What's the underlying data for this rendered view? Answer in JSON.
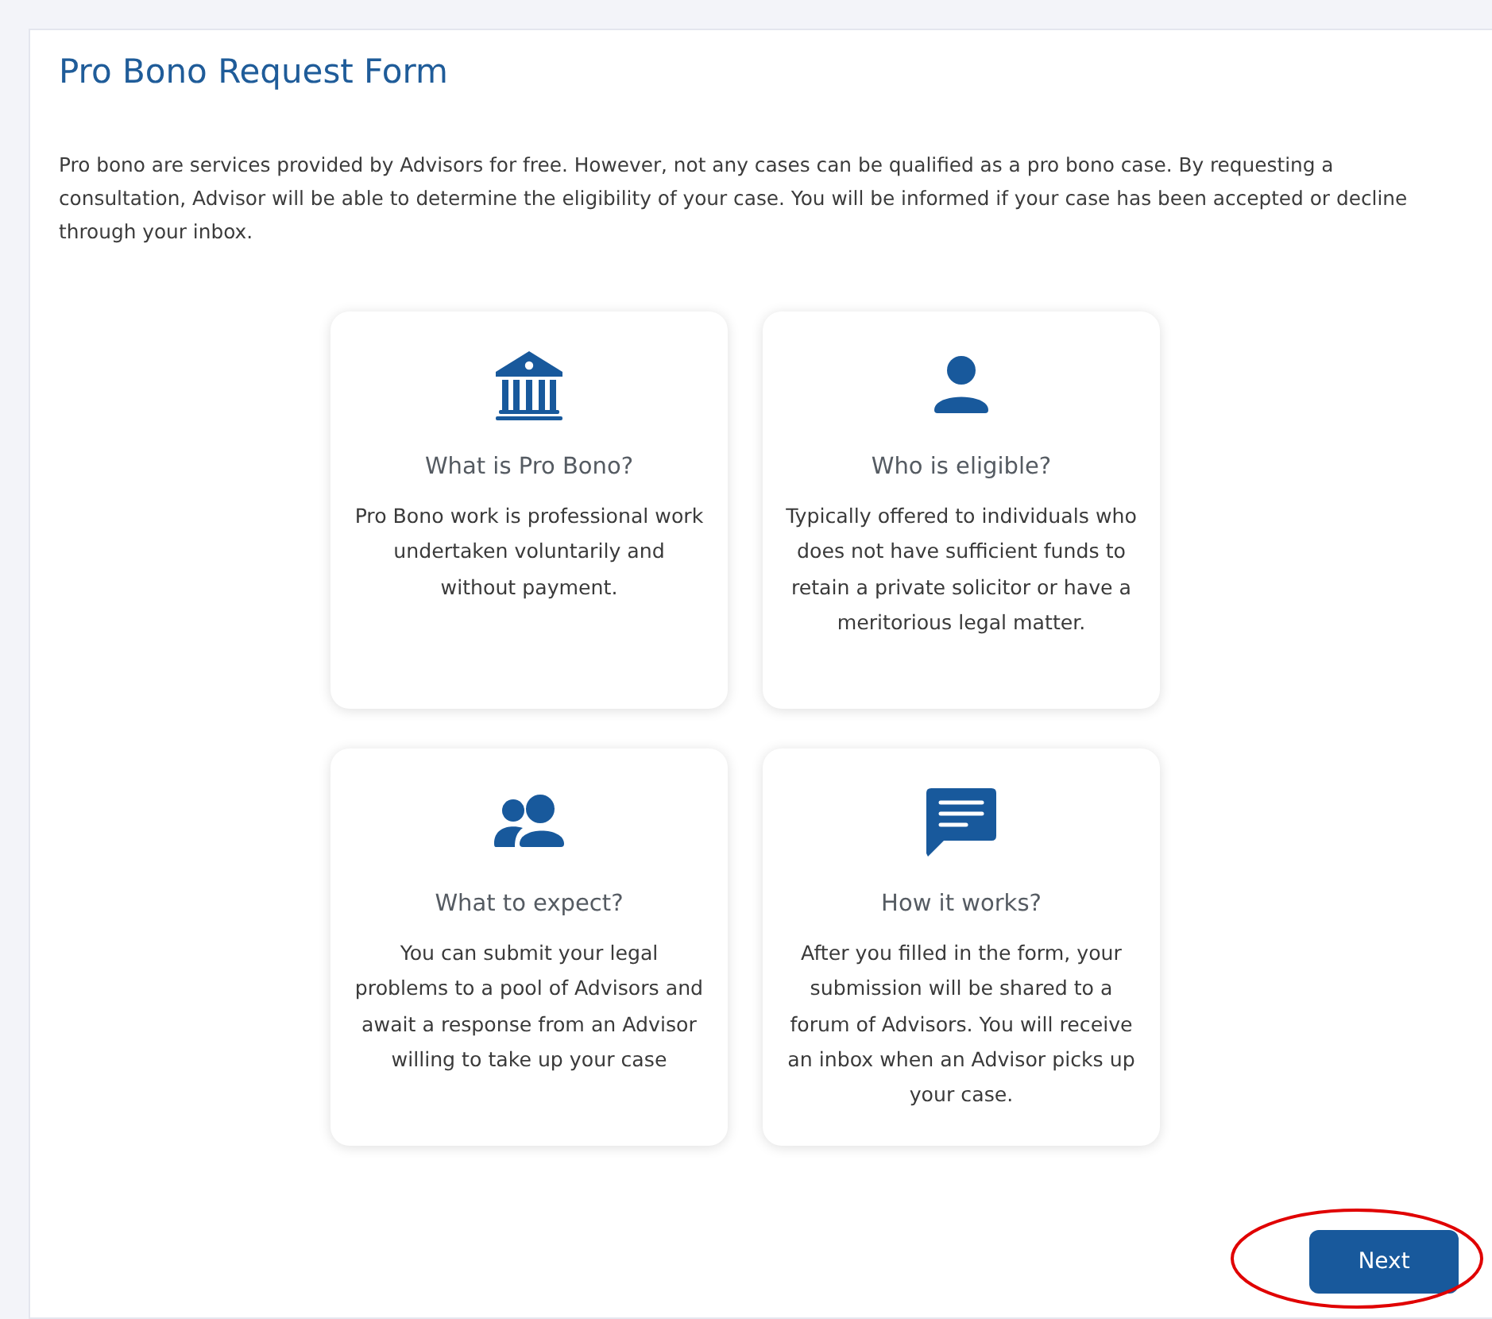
{
  "title": "Pro Bono Request Form",
  "intro": "Pro bono are services provided by Advisors for free. However, not any cases can be qualified as a pro bono case. By requesting a consultation, Advisor will be able to determine the eligibility of your case. You will be informed if your case has been accepted or decline through your inbox.",
  "cards": [
    {
      "heading": "What is Pro Bono?",
      "text": "Pro Bono work is professional work undertaken voluntarily and without payment."
    },
    {
      "heading": "Who is eligible?",
      "text": "Typically offered to individuals who does not have sufficient funds to retain a private solicitor or have a meritorious legal matter."
    },
    {
      "heading": "What to expect?",
      "text": "You can submit your legal problems to a pool of Advisors and await a response from an Advisor willing to take up your case"
    },
    {
      "heading": "How it works?",
      "text": "After you filled in the form, your submission will be shared to a forum of Advisors. You will receive an inbox when an Advisor picks up your case."
    }
  ],
  "next_button": {
    "label": "Next",
    "highlighted": true
  }
}
